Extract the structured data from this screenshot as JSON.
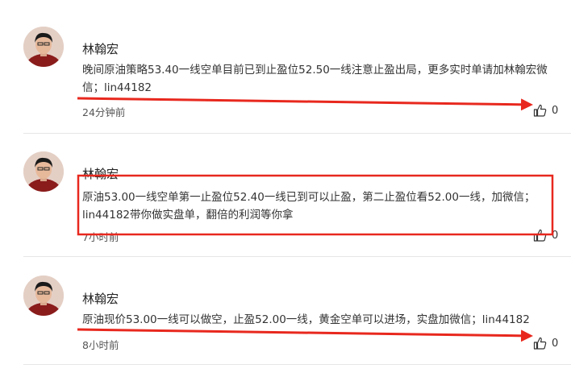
{
  "comments": [
    {
      "user": "林翰宏",
      "text": "晚间原油策略53.40一线空单目前已到止盈位52.50一线注意止盈出局，更多实时单请加林翰宏微信；lin44182",
      "time": "24分钟前",
      "likes": "0"
    },
    {
      "user": "林翰宏",
      "text": "原油53.00一线空单第一止盈位52.40一线已到可以止盈，第二止盈位看52.00一线，加微信；lin44182带你做实盘单，翻倍的利润等你拿",
      "time": "7小时前",
      "likes": "0"
    },
    {
      "user": "林翰宏",
      "text": "原油现价53.00一线可以做空，止盈52.00一线，黄金空单可以进场，实盘加微信；lin44182",
      "time": "8小时前",
      "likes": "0"
    }
  ],
  "colors": {
    "annotation_red": "#e8281e",
    "divider": "#e6e6e6"
  },
  "icons": {
    "like": "thumbs-up-icon",
    "avatar": "user-avatar"
  }
}
